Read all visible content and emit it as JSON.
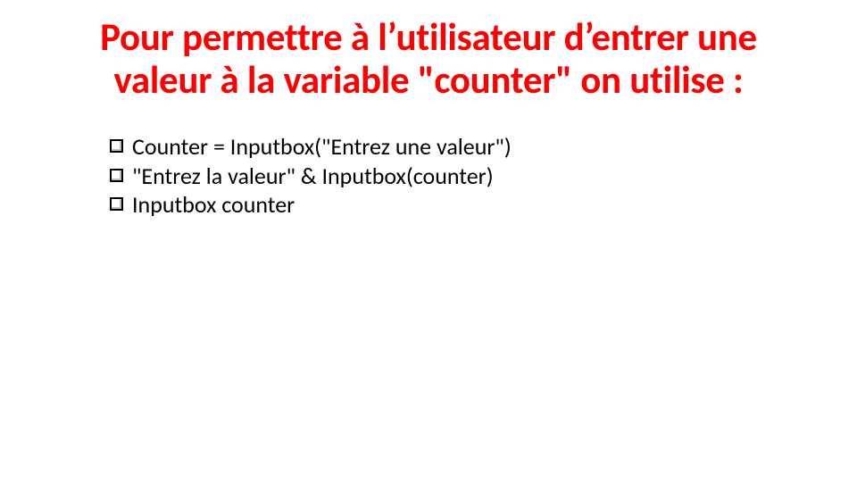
{
  "slide": {
    "title": "Pour permettre à l’utilisateur d’entrer une valeur à la variable \"counter\" on utilise :",
    "options": [
      "Counter = Inputbox(\"Entrez une valeur\")",
      "\"Entrez la valeur\" & Inputbox(counter)",
      "Inputbox counter"
    ]
  }
}
